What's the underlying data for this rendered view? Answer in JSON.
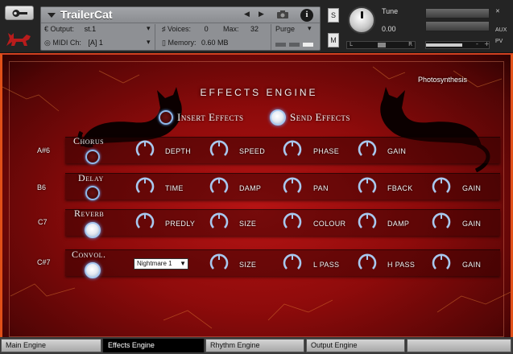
{
  "header": {
    "instrument_name": "TrailerCat",
    "output_label": "Output:",
    "output_value": "st.1",
    "voices_label": "Voices:",
    "voices_value": "0",
    "max_label": "Max:",
    "max_value": "32",
    "purge_label": "Purge",
    "midi_label": "MIDI Ch:",
    "midi_value": "[A] 1",
    "memory_label": "Memory:",
    "memory_value": "0.60 MB",
    "solo_label": "S",
    "mute_label": "M",
    "tune_label": "Tune",
    "tune_value": "0.00",
    "pan_left": "L",
    "pan_right": "R",
    "vol_minus": "-",
    "vol_plus": "+",
    "aux_label": "AUX",
    "pv_label": "PV",
    "prev_arrow": "◀",
    "next_arrow": "▶",
    "info_label": "i",
    "dropdown_arrow": "▾"
  },
  "engine": {
    "title": "EFFECTS ENGINE",
    "preset_name": "Photosynthesis",
    "insert_label": "Insert Effects",
    "send_label": "Send Effects",
    "selected": "send"
  },
  "effects": [
    {
      "note": "A#6",
      "name": "Chorus",
      "active": false,
      "params": [
        "DEPTH",
        "SPEED",
        "PHASE",
        "GAIN"
      ]
    },
    {
      "note": "B6",
      "name": "Delay",
      "active": false,
      "params": [
        "TIME",
        "DAMP",
        "PAN",
        "FBACK",
        "GAIN"
      ]
    },
    {
      "note": "C7",
      "name": "Reverb",
      "active": true,
      "params": [
        "PREDLY",
        "SIZE",
        "COLOUR",
        "DAMP",
        "GAIN"
      ]
    },
    {
      "note": "C#7",
      "name": "Convol.",
      "active": true,
      "ir_select": "Nightmare 1",
      "params": [
        "SIZE",
        "L PASS",
        "H PASS",
        "GAIN"
      ]
    }
  ],
  "tabs": [
    {
      "label": "Main Engine",
      "active": false
    },
    {
      "label": "Effects Engine",
      "active": true
    },
    {
      "label": "Rhythm Engine",
      "active": false
    },
    {
      "label": "Output Engine",
      "active": false
    }
  ],
  "colors": {
    "panel_red": "#b61414",
    "frame_orange": "#e05018",
    "knob_blue": "#8fb8e8"
  }
}
